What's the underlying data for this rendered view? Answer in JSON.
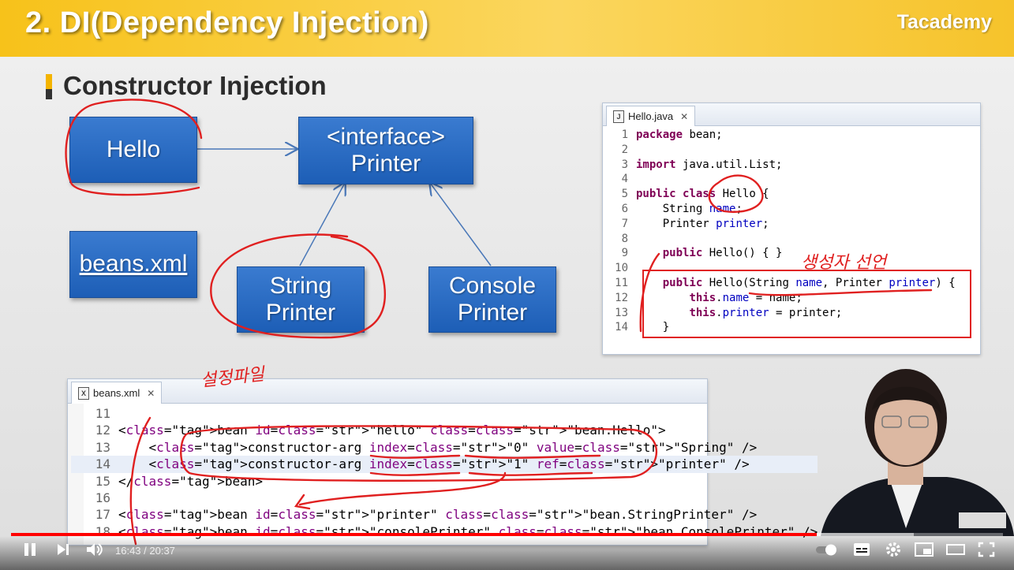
{
  "slide": {
    "title": "2. DI(Dependency Injection)",
    "brand": "Tacademy",
    "section_title": "Constructor Injection",
    "boxes": {
      "hello": "Hello",
      "interface_line1": "<interface>",
      "interface_line2": "Printer",
      "beans": "beans.xml",
      "string_line1": "String",
      "string_line2": "Printer",
      "console_line1": "Console",
      "console_line2": "Printer"
    },
    "annotations": {
      "constructor_decl": "생성자 선언",
      "setting": "설정파일"
    }
  },
  "java_editor": {
    "tab_label": "Hello.java",
    "lines": [
      {
        "n": "1",
        "code": "package bean;"
      },
      {
        "n": "2",
        "code": ""
      },
      {
        "n": "3",
        "code": "import java.util.List;"
      },
      {
        "n": "4",
        "code": ""
      },
      {
        "n": "5",
        "code": "public class Hello {"
      },
      {
        "n": "6",
        "code": "    String name;"
      },
      {
        "n": "7",
        "code": "    Printer printer;"
      },
      {
        "n": "8",
        "code": ""
      },
      {
        "n": "9",
        "code": "    public Hello() { }"
      },
      {
        "n": "10",
        "code": ""
      },
      {
        "n": "11",
        "code": "    public Hello(String name, Printer printer) {"
      },
      {
        "n": "12",
        "code": "        this.name = name;"
      },
      {
        "n": "13",
        "code": "        this.printer = printer;"
      },
      {
        "n": "14",
        "code": "    }"
      }
    ]
  },
  "xml_editor": {
    "tab_label": "beans.xml",
    "lines": [
      {
        "n": "11",
        "code": ""
      },
      {
        "n": "12",
        "code": "<bean id=\"hello\" class=\"bean.Hello\">"
      },
      {
        "n": "13",
        "code": "    <constructor-arg index=\"0\" value=\"Spring\" />"
      },
      {
        "n": "14",
        "code": "    <constructor-arg index=\"1\" ref=\"printer\" />"
      },
      {
        "n": "15",
        "code": "</bean>"
      },
      {
        "n": "16",
        "code": ""
      },
      {
        "n": "17",
        "code": "<bean id=\"printer\" class=\"bean.StringPrinter\" />"
      },
      {
        "n": "18",
        "code": "<bean id=\"consolePrinter\" class=\"bean.ConsolePrinter\" />"
      }
    ]
  },
  "player": {
    "time_display": "16:43 / 20:37",
    "progress": 0.812,
    "buffered": 0.91
  },
  "colors": {
    "header_yellow": "#f7c21a",
    "box_blue": "#2563be",
    "annotation_red": "#e02020",
    "progress_red": "#ff0000"
  }
}
